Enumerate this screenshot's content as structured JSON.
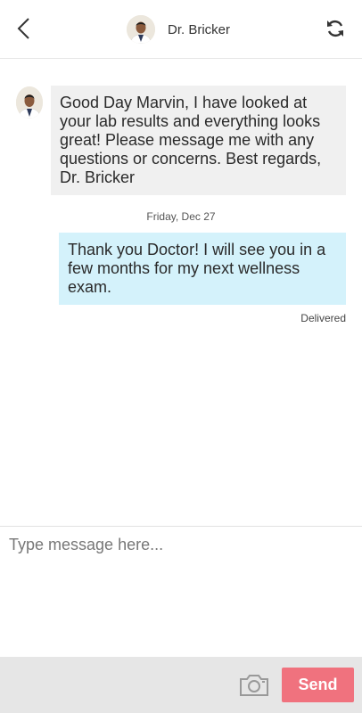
{
  "header": {
    "title": "Dr. Bricker",
    "back_icon": "chevron-left-icon",
    "refresh_icon": "refresh-icon"
  },
  "messages": [
    {
      "direction": "incoming",
      "text": "Good Day Marvin, I have looked at your lab results and everything looks great! Please message me with any questions or concerns. Best regards, Dr. Bricker"
    },
    {
      "direction": "separator",
      "text": "Friday, Dec 27"
    },
    {
      "direction": "outgoing",
      "text": "Thank you Doctor! I will see you in a few months for my next wellness exam.",
      "status": "Delivered"
    }
  ],
  "composer": {
    "placeholder": "Type message here...",
    "value": ""
  },
  "footer": {
    "camera_icon": "camera-icon",
    "send_label": "Send"
  },
  "colors": {
    "incoming_bubble": "#f0f0f0",
    "outgoing_bubble": "#d4f2fb",
    "send_button": "#f0727e",
    "bottom_bar": "#e6e6e6"
  }
}
